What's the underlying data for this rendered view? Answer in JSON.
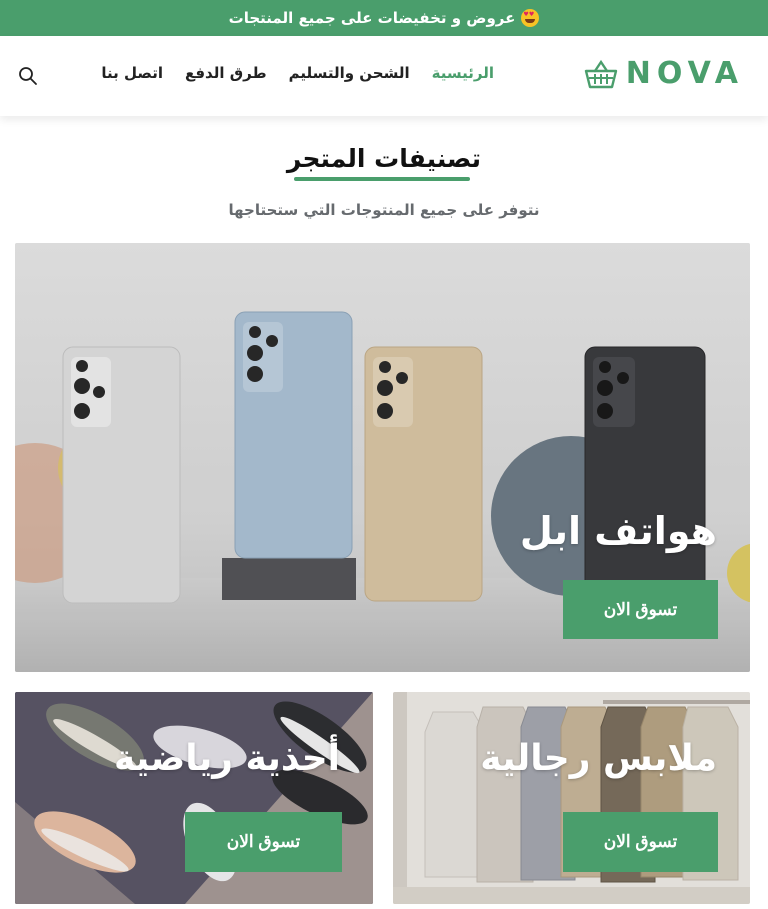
{
  "announcement": {
    "text": "عروض و تخفيضات على جميع المنتجات",
    "emoji_icon": "star-struck-face-icon"
  },
  "header": {
    "logo_text": "NOVA",
    "logo_icon": "basket-icon",
    "nav": [
      {
        "label": "الرئيسية",
        "active": true
      },
      {
        "label": "الشحن والتسليم",
        "active": false
      },
      {
        "label": "طرق الدفع",
        "active": false
      },
      {
        "label": "اتصل بنا",
        "active": false
      }
    ],
    "search_icon": "search-icon"
  },
  "section": {
    "title": "تصنيفات المتجر",
    "subtitle": "نتوفر على جميع المنتوجات التي ستحتاجها"
  },
  "categories": [
    {
      "title": "هواتف ابل",
      "cta": "تسوق الان"
    },
    {
      "title": "أحذية رياضية",
      "cta": "تسوق الان"
    },
    {
      "title": "ملابس رجالية",
      "cta": "تسوق الان"
    }
  ],
  "colors": {
    "accent": "#4a9e6c",
    "text": "#222222",
    "muted": "#666a6e"
  }
}
